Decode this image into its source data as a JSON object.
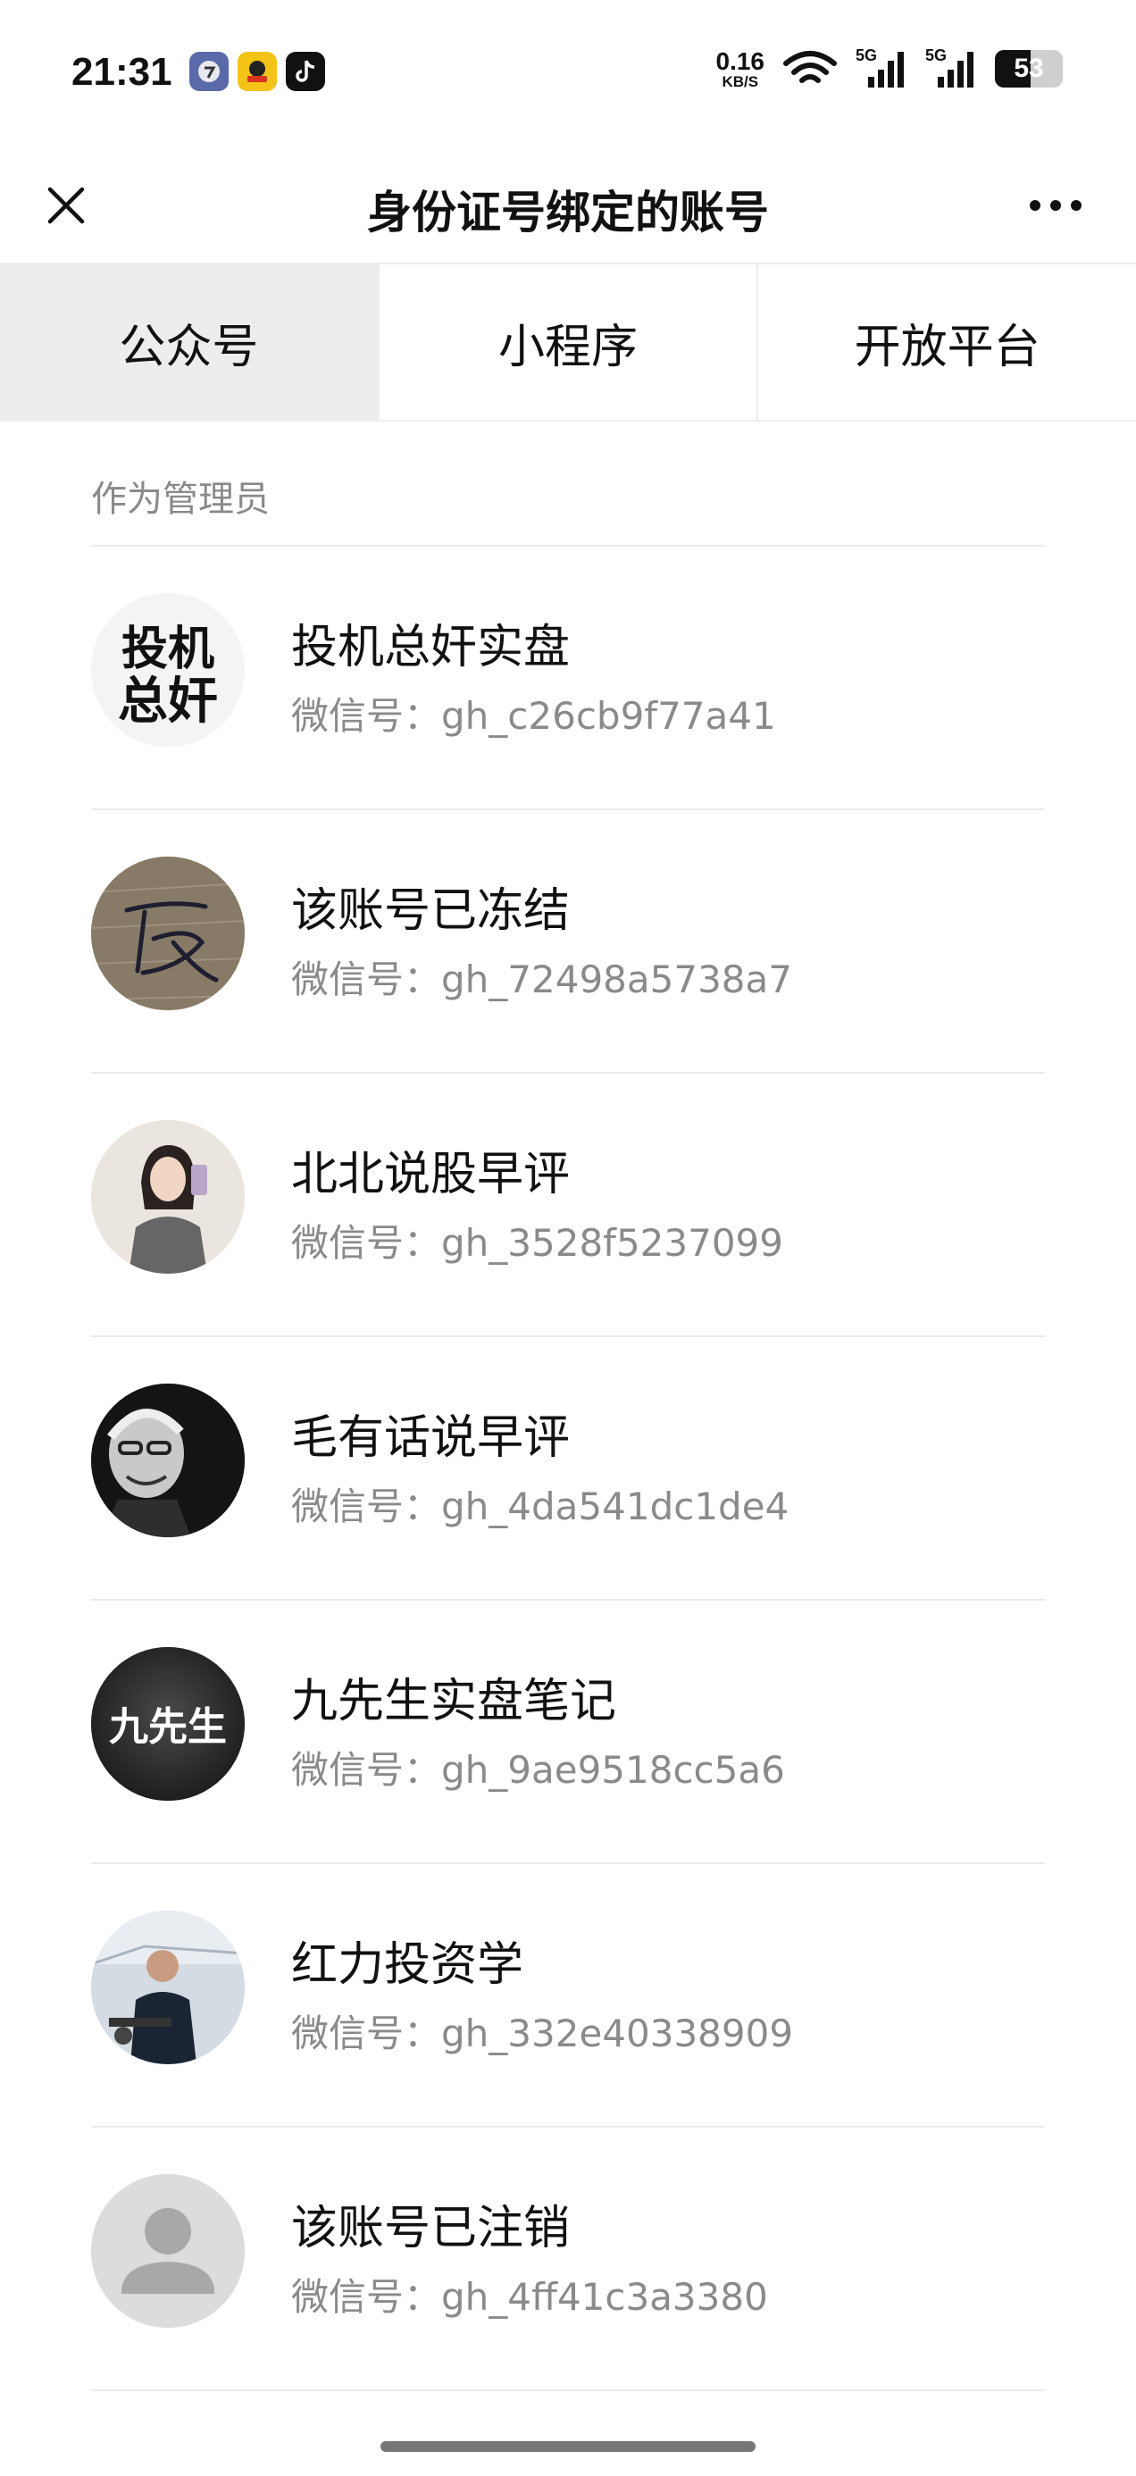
{
  "status_bar": {
    "time": "21:31",
    "netspeed_value": "0.16",
    "netspeed_unit": "KB/S",
    "signal_label_1": "5G",
    "signal_label_2": "5G",
    "battery_level": "53",
    "battery_fraction": 0.53
  },
  "header": {
    "title": "身份证号绑定的账号"
  },
  "tabs": [
    {
      "label": "公众号",
      "active": true
    },
    {
      "label": "小程序",
      "active": false
    },
    {
      "label": "开放平台",
      "active": false
    }
  ],
  "section": {
    "label": "作为管理员"
  },
  "accounts": [
    {
      "name": "投机总奸实盘",
      "wxid": "微信号：gh_c26cb9f77a41",
      "avatar_text": "投机总奸"
    },
    {
      "name": "该账号已冻结",
      "wxid": "微信号：gh_72498a5738a7",
      "avatar_text": ""
    },
    {
      "name": "北北说股早评",
      "wxid": "微信号：gh_3528f5237099",
      "avatar_text": ""
    },
    {
      "name": "毛有话说早评",
      "wxid": "微信号：gh_4da541dc1de4",
      "avatar_text": ""
    },
    {
      "name": "九先生实盘笔记",
      "wxid": "微信号：gh_9ae9518cc5a6",
      "avatar_text": "九先生"
    },
    {
      "name": "红力投资学",
      "wxid": "微信号：gh_332e40338909",
      "avatar_text": ""
    },
    {
      "name": "该账号已注销",
      "wxid": "微信号：gh_4ff41c3a3380",
      "avatar_text": ""
    }
  ]
}
